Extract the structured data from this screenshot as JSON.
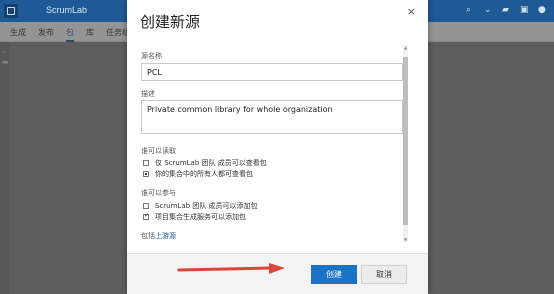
{
  "app": {
    "title": "ScrumLab",
    "tabs": [
      "生成",
      "发布",
      "包",
      "库",
      "任务组"
    ]
  },
  "dialog": {
    "title": "创建新源",
    "close_glyph": "×",
    "name": {
      "label": "源名称",
      "value": "PCL"
    },
    "description": {
      "label": "描述",
      "value": "Private common library for whole organization"
    },
    "read": {
      "label": "谁可以读取",
      "options": [
        {
          "label": "仅 ScrumLab 团队 成员可以查看包",
          "selected": false
        },
        {
          "label": "你的集合中的所有人都可查看包",
          "selected": true
        }
      ]
    },
    "contribute": {
      "label": "谁可以参与",
      "options": [
        {
          "label": "ScrumLab 团队 成员可以添加包",
          "checked": false
        },
        {
          "label": "项目集合生成服务可以添加包",
          "checked": true
        }
      ]
    },
    "upstream": {
      "prefix": "包括",
      "link": "上游源"
    },
    "create_label": "创建",
    "cancel_label": "取消"
  },
  "colors": {
    "topbar": "#1f5a96",
    "primary_button": "#1a73c7",
    "annotation_arrow": "#d9453a"
  }
}
